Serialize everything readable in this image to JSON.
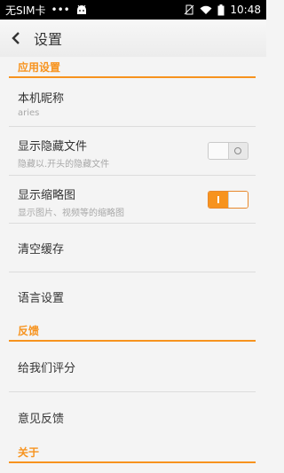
{
  "status_bar": {
    "carrier": "无SIM卡",
    "dots": "•••",
    "time": "10:48"
  },
  "titlebar": {
    "title": "设置"
  },
  "sections": {
    "app_settings": "应用设置",
    "feedback": "反馈",
    "about": "关于"
  },
  "rows": {
    "nickname": {
      "title": "本机昵称",
      "subtitle": "aries"
    },
    "hidden_files": {
      "title": "显示隐藏文件",
      "subtitle": "隐藏以.开头的隐藏文件",
      "toggle_on": false
    },
    "thumbnails": {
      "title": "显示缩略图",
      "subtitle": "显示图片、视频等的缩略图",
      "toggle_on": true
    },
    "clear_cache": {
      "title": "清空缓存"
    },
    "language": {
      "title": "语言设置"
    },
    "rate": {
      "title": "给我们评分"
    },
    "feedback": {
      "title": "意见反馈"
    }
  },
  "colors": {
    "accent": "#f7931e",
    "statusbar_bg": "#000000",
    "page_bg": "#f4f4f4"
  },
  "icons": {
    "status_left": [
      "android-icon"
    ],
    "status_right": [
      "no-sim-icon",
      "wifi-icon",
      "battery-icon"
    ],
    "back": "back-arrow-icon"
  }
}
